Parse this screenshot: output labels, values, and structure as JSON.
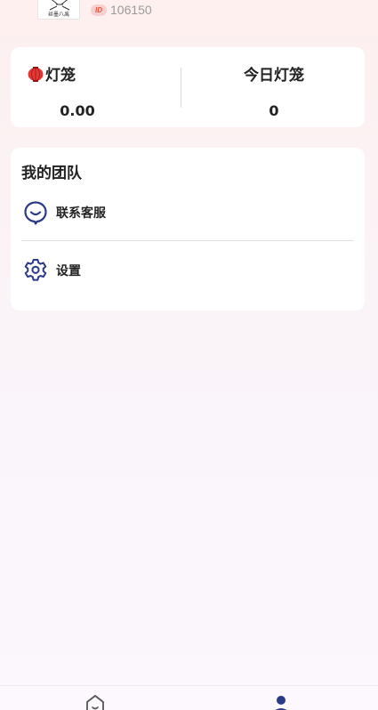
{
  "profile": {
    "avatar_caption": "丝墨八禹",
    "id_badge": "ID",
    "id_value": "106150"
  },
  "stats": {
    "lantern": {
      "label": "灯笼",
      "value": "0.00"
    },
    "today_lantern": {
      "label": "今日灯笼",
      "value": "0"
    }
  },
  "team": {
    "title": "我的团队",
    "items": [
      {
        "label": "联系客服",
        "icon": "customer-service-icon"
      },
      {
        "label": "设置",
        "icon": "gear-icon"
      }
    ]
  },
  "tabbar": {
    "items": [
      {
        "icon": "home-icon",
        "active": false
      },
      {
        "icon": "user-icon",
        "active": true
      }
    ]
  },
  "colors": {
    "accent": "#2b3a86",
    "lantern_red": "#e53935",
    "id_badge_bg": "#f8cfcf",
    "id_badge_text": "#e7553d"
  }
}
